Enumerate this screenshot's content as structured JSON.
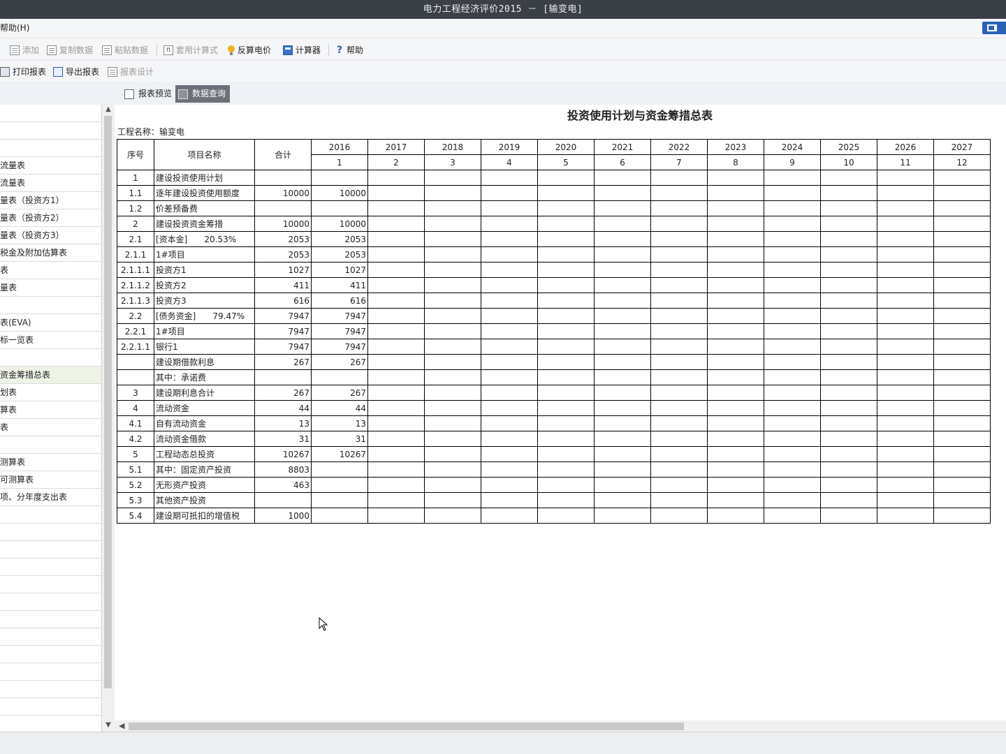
{
  "window": {
    "title": "电力工程经济评价2015 － [输变电]"
  },
  "menu": {
    "help": "帮助(H)"
  },
  "toolbar1": {
    "add": "添加",
    "copy": "复制数据",
    "paste": "粘贴数据",
    "formula": "套用计算式",
    "reverse_price": "反算电价",
    "calculator": "计算器",
    "help": "帮助"
  },
  "toolbar2": {
    "print": "打印报表",
    "export": "导出报表",
    "design": "报表设计"
  },
  "tabs": {
    "preview": "报表预览",
    "query": "数据查询"
  },
  "sidebar": {
    "items": [
      "",
      "",
      "",
      "流量表",
      "流量表",
      "量表（投资方1）",
      "量表（投资方2）",
      "量表（投资方3）",
      "税金及附加估算表",
      "表",
      "量表",
      "",
      "表(EVA)",
      "标一览表",
      "",
      "资金筹措总表",
      "划表",
      "算表",
      "表",
      "",
      "测算表",
      "可测算表",
      "项、分年度支出表",
      "",
      "",
      "",
      "",
      "",
      "",
      "",
      "",
      "",
      "",
      "",
      "",
      ""
    ]
  },
  "report": {
    "title": "投资使用计划与资金筹措总表",
    "project_label": "工程名称：输变电",
    "headers": {
      "seq": "序号",
      "name": "项目名称",
      "total": "合计"
    },
    "years": [
      "2016",
      "2017",
      "2018",
      "2019",
      "2020",
      "2021",
      "2022",
      "2023",
      "2024",
      "2025",
      "2026",
      "2027"
    ],
    "year_index": [
      "1",
      "2",
      "3",
      "4",
      "5",
      "6",
      "7",
      "8",
      "9",
      "10",
      "11",
      "12"
    ],
    "rows": [
      {
        "seq": "1",
        "name": "建设投资使用计划",
        "total": "",
        "y2016": ""
      },
      {
        "seq": "1.1",
        "name": "逐年建设投资使用额度",
        "total": "10000",
        "y2016": "10000"
      },
      {
        "seq": "1.2",
        "name": "价差预备费",
        "total": "",
        "y2016": ""
      },
      {
        "seq": "2",
        "name": "建设投资资金筹措",
        "total": "10000",
        "y2016": "10000"
      },
      {
        "seq": "2.1",
        "name": "[资本金]　　20.53%",
        "total": "2053",
        "y2016": "2053"
      },
      {
        "seq": "2.1.1",
        "name": "1#项目",
        "total": "2053",
        "y2016": "2053"
      },
      {
        "seq": "2.1.1.1",
        "name": "投资方1",
        "total": "1027",
        "y2016": "1027"
      },
      {
        "seq": "2.1.1.2",
        "name": "投资方2",
        "total": "411",
        "y2016": "411"
      },
      {
        "seq": "2.1.1.3",
        "name": "投资方3",
        "total": "616",
        "y2016": "616"
      },
      {
        "seq": "2.2",
        "name": "[债务资金]　　79.47%",
        "total": "7947",
        "y2016": "7947"
      },
      {
        "seq": "2.2.1",
        "name": "1#项目",
        "total": "7947",
        "y2016": "7947"
      },
      {
        "seq": "2.2.1.1",
        "name": "银行1",
        "total": "7947",
        "y2016": "7947"
      },
      {
        "seq": "",
        "name": "建设期借款利息",
        "total": "267",
        "y2016": "267"
      },
      {
        "seq": "",
        "name": "其中：承诺费",
        "total": "",
        "y2016": ""
      },
      {
        "seq": "3",
        "name": "建设期利息合计",
        "total": "267",
        "y2016": "267"
      },
      {
        "seq": "4",
        "name": "流动资金",
        "total": "44",
        "y2016": "44"
      },
      {
        "seq": "4.1",
        "name": "自有流动资金",
        "total": "13",
        "y2016": "13"
      },
      {
        "seq": "4.2",
        "name": "流动资金借款",
        "total": "31",
        "y2016": "31"
      },
      {
        "seq": "5",
        "name": "工程动态总投资",
        "total": "10267",
        "y2016": "10267"
      },
      {
        "seq": "5.1",
        "name": "其中：固定资产投资",
        "total": "8803",
        "y2016": ""
      },
      {
        "seq": "5.2",
        "name": "无形资产投资",
        "total": "463",
        "y2016": ""
      },
      {
        "seq": "5.3",
        "name": "其他资产投资",
        "total": "",
        "y2016": ""
      },
      {
        "seq": "5.4",
        "name": "建设期可抵扣的增值税",
        "total": "1000",
        "y2016": ""
      }
    ]
  }
}
